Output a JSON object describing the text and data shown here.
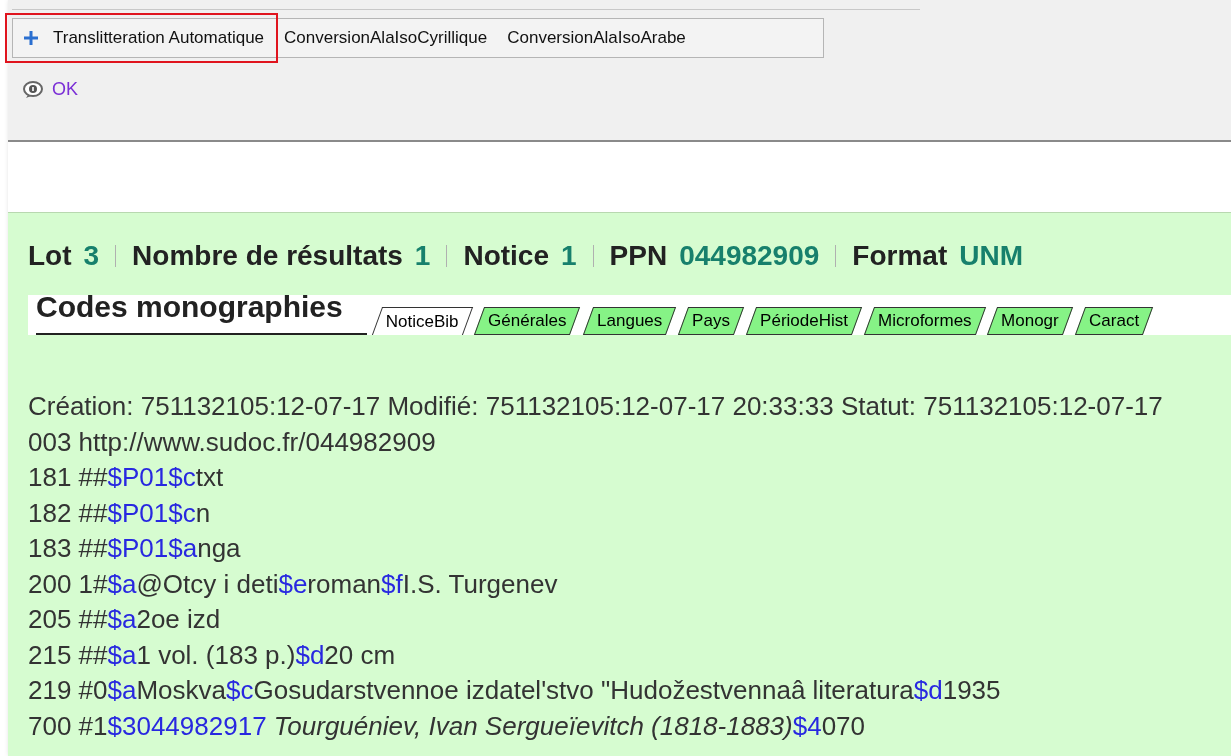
{
  "toolbar": {
    "buttons": [
      {
        "label": "Translitteration Automatique",
        "kind": "add",
        "highlighted": true
      },
      {
        "label": "ConversionAlaIsoCyrillique",
        "kind": "plain",
        "highlighted": false
      },
      {
        "label": "ConversionAlaIsoArabe",
        "kind": "plain",
        "highlighted": false
      }
    ]
  },
  "ok_link": "OK",
  "summary": [
    {
      "label": "Lot",
      "value": "3"
    },
    {
      "label": "Nombre de résultats",
      "value": "1"
    },
    {
      "label": "Notice",
      "value": "1"
    },
    {
      "label": "PPN",
      "value": "044982909"
    },
    {
      "label": "Format",
      "value": "UNM"
    }
  ],
  "section_title": "Codes monographies",
  "tabs": [
    {
      "label": "NoticeBib",
      "selected": true
    },
    {
      "label": "Générales",
      "selected": false
    },
    {
      "label": "Langues",
      "selected": false
    },
    {
      "label": "Pays",
      "selected": false
    },
    {
      "label": "PériodeHist",
      "selected": false
    },
    {
      "label": "Microformes",
      "selected": false
    },
    {
      "label": "Monogr",
      "selected": false
    },
    {
      "label": "Caract",
      "selected": false
    }
  ],
  "record_lines": [
    [
      {
        "kind": "plain",
        "text": "Création: 751132105:12-07-17 Modifié: 751132105:12-07-17 20:33:33 Statut: 751132105:12-07-17"
      }
    ],
    [
      {
        "kind": "plain",
        "text": "003 http://www.sudoc.fr/044982909"
      }
    ],
    [
      {
        "kind": "plain",
        "text": "181 ##"
      },
      {
        "kind": "code",
        "text": "$P01$c"
      },
      {
        "kind": "plain",
        "text": "txt"
      }
    ],
    [
      {
        "kind": "plain",
        "text": "182 ##"
      },
      {
        "kind": "code",
        "text": "$P01$c"
      },
      {
        "kind": "plain",
        "text": "n"
      }
    ],
    [
      {
        "kind": "plain",
        "text": "183 ##"
      },
      {
        "kind": "code",
        "text": "$P01$a"
      },
      {
        "kind": "plain",
        "text": "nga"
      }
    ],
    [
      {
        "kind": "plain",
        "text": "200 1#"
      },
      {
        "kind": "code",
        "text": "$a"
      },
      {
        "kind": "plain",
        "text": "@Otcy i deti"
      },
      {
        "kind": "code",
        "text": "$e"
      },
      {
        "kind": "plain",
        "text": "roman"
      },
      {
        "kind": "code",
        "text": "$f"
      },
      {
        "kind": "plain",
        "text": "I.S. Turgenev"
      }
    ],
    [
      {
        "kind": "plain",
        "text": "205 ##"
      },
      {
        "kind": "code",
        "text": "$a"
      },
      {
        "kind": "plain",
        "text": "2oe izd"
      }
    ],
    [
      {
        "kind": "plain",
        "text": "215 ##"
      },
      {
        "kind": "code",
        "text": "$a"
      },
      {
        "kind": "plain",
        "text": "1 vol. (183 p.)"
      },
      {
        "kind": "code",
        "text": "$d"
      },
      {
        "kind": "plain",
        "text": "20 cm"
      }
    ],
    [
      {
        "kind": "plain",
        "text": "219 #0"
      },
      {
        "kind": "code",
        "text": "$a"
      },
      {
        "kind": "plain",
        "text": "Moskva"
      },
      {
        "kind": "code",
        "text": "$c"
      },
      {
        "kind": "plain",
        "text": "Gosudarstvennoe izdatel'stvo \"Hudožestvennaâ literatura"
      },
      {
        "kind": "code",
        "text": "$d"
      },
      {
        "kind": "plain",
        "text": "1935"
      }
    ],
    [
      {
        "kind": "plain",
        "text": "700 #1"
      },
      {
        "kind": "code",
        "text": "$3044982917"
      },
      {
        "kind": "italic",
        "text": " Tourguéniev, Ivan Sergueïevitch (1818-1883)"
      },
      {
        "kind": "code",
        "text": "$4"
      },
      {
        "kind": "plain",
        "text": "070"
      }
    ]
  ]
}
